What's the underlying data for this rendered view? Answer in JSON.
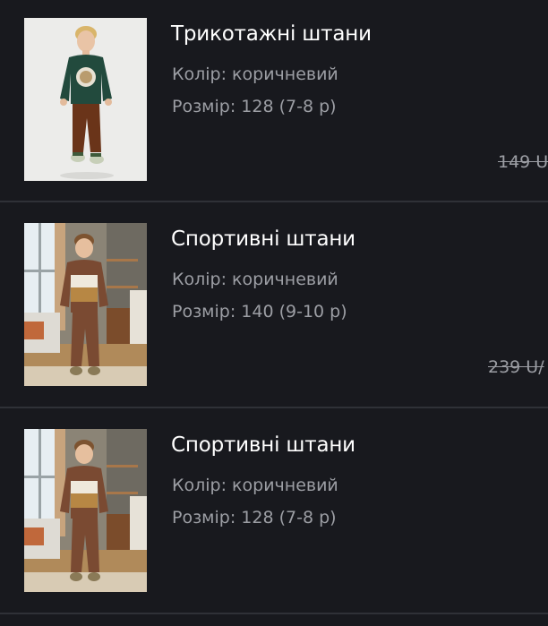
{
  "items": [
    {
      "title": "Трикотажні штани",
      "color_line": "Колір: коричневий",
      "size_line": "Розмір: 128 (7-8 р)",
      "old_price": "149 U"
    },
    {
      "title": "Спортивні штани",
      "color_line": "Колір: коричневий",
      "size_line": "Розмір: 140 (9-10 р)",
      "old_price": "239 U/"
    },
    {
      "title": "Спортивні штани",
      "color_line": "Колір: коричневий",
      "size_line": "Розмір: 128 (7-8 р)"
    }
  ],
  "colors": {
    "background": "#18191e",
    "divider": "#2f3137",
    "title_text": "#ffffff",
    "secondary_text": "#9c9ea4"
  }
}
